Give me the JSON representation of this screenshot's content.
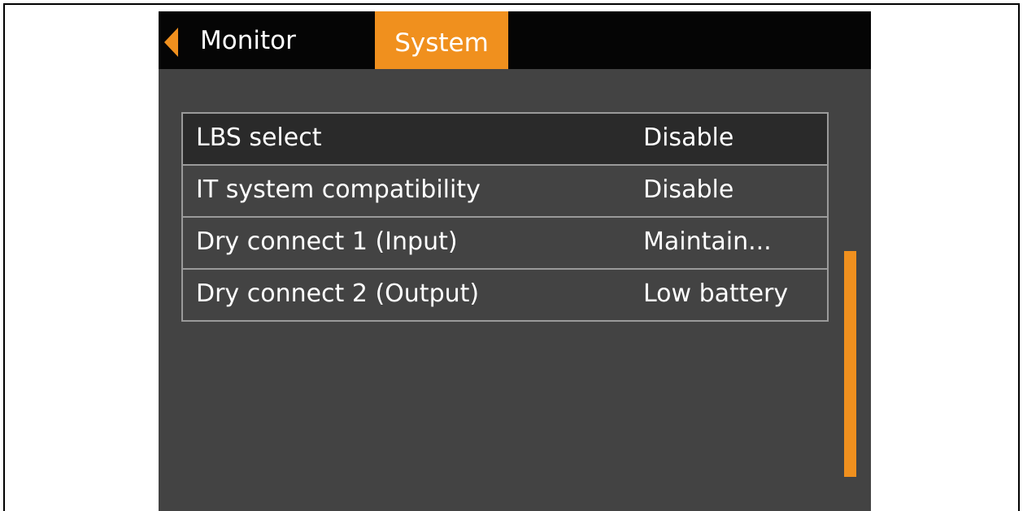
{
  "header": {
    "tabs": [
      {
        "label": "Monitor"
      },
      {
        "label": "System",
        "active": true
      }
    ]
  },
  "settings": {
    "rows": [
      {
        "label": "LBS select",
        "value": "Disable",
        "selected": true
      },
      {
        "label": "IT system compatibility",
        "value": "Disable"
      },
      {
        "label": "Dry connect 1 (Input)",
        "value": "Maintain..."
      },
      {
        "label": "Dry connect 2 (Output)",
        "value": "Low battery"
      }
    ]
  },
  "colors": {
    "accent": "#f0901e",
    "panel_background": "#434343",
    "topbar_background": "#050505",
    "selected_row": "#2a2a2a",
    "row_border": "#9a9a9a"
  },
  "icons": {
    "back": "back-arrow-icon"
  }
}
